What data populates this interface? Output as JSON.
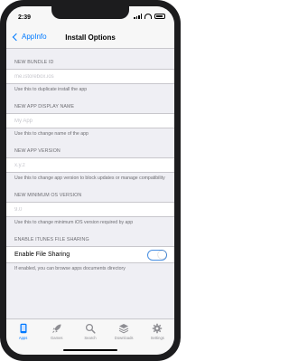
{
  "status": {
    "time": "2:39"
  },
  "nav": {
    "back_label": "AppInfo",
    "title": "Install Options"
  },
  "sections": {
    "bundle_id": {
      "header": "NEW BUNDLE ID",
      "placeholder": "me.istorebox.ios",
      "footer": "Use this to duplicate install the app"
    },
    "display_name": {
      "header": "NEW APP DISPLAY NAME",
      "placeholder": "My App",
      "footer": "Use this to change name of the app"
    },
    "app_version": {
      "header": "NEW APP VERSION",
      "placeholder": "x.y.z",
      "footer": "Use this to change app version to block updates or manage compatibility"
    },
    "min_os": {
      "header": "NEW MINIMUM OS VERSION",
      "placeholder": "9.0",
      "footer": "Use this to change minimum iOS version required by app"
    },
    "file_sharing": {
      "header": "ENABLE ITUNES FILE SHARING",
      "label": "Enable File Sharing",
      "footer": "If enabled, you can browse apps documents directory"
    }
  },
  "tabs": [
    {
      "label": "Apps",
      "icon": "apps-icon",
      "active": true
    },
    {
      "label": "Games",
      "icon": "rocket-icon",
      "active": false
    },
    {
      "label": "Search",
      "icon": "search-icon",
      "active": false
    },
    {
      "label": "Downloads",
      "icon": "layers-icon",
      "active": false
    },
    {
      "label": "Settings",
      "icon": "gear-icon",
      "active": false
    }
  ],
  "colors": {
    "accent": "#007aff",
    "background": "#efeff4",
    "inactive": "#8e8e93"
  }
}
